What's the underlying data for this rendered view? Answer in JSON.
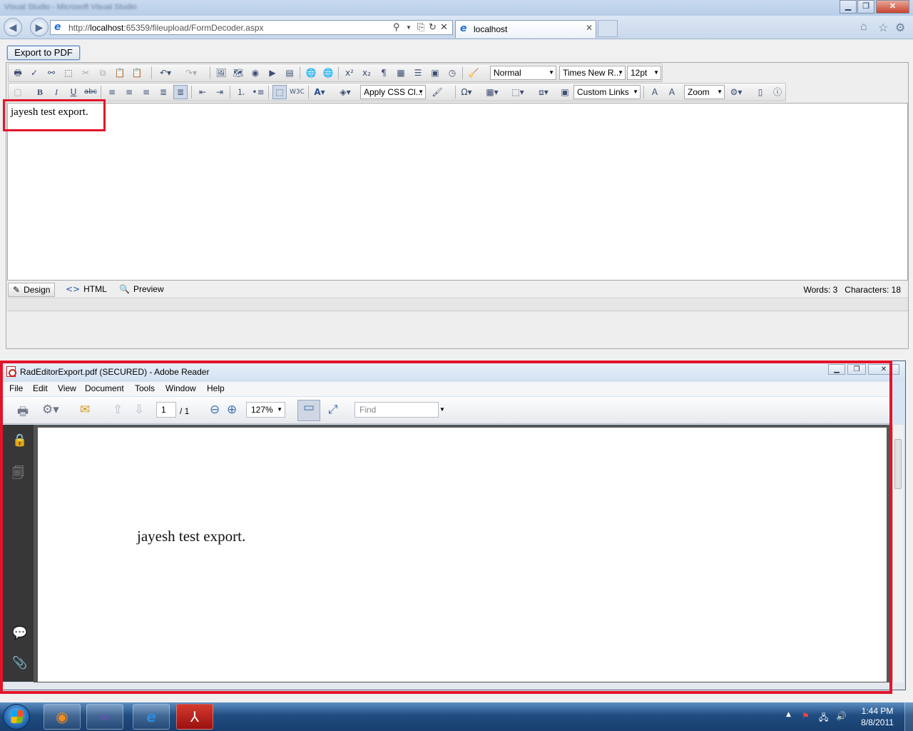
{
  "browser": {
    "title_blurred": "Visual Studio - Microsoft Visual Studio",
    "address": {
      "prefix": "http://",
      "host": "localhost",
      "rest": ":65359/fileupload/FormDecoder.aspx"
    },
    "tab_label": "localhost"
  },
  "page": {
    "export_button": "Export to PDF"
  },
  "editor": {
    "paragraph_style": "Normal",
    "font_name": "Times New R...",
    "font_size": "12pt",
    "css_class": "Apply CSS Cl...",
    "custom_links": "Custom Links",
    "zoom": "Zoom",
    "content_text": "jayesh test export.",
    "modes": [
      "Design",
      "HTML",
      "Preview"
    ],
    "words_label": "Words: 3",
    "chars_label": "Characters: 18"
  },
  "adobe": {
    "title": "RadEditorExport.pdf (SECURED) - Adobe Reader",
    "menu": [
      "File",
      "Edit",
      "View",
      "Document",
      "Tools",
      "Window",
      "Help"
    ],
    "page_current": "1",
    "page_total": "/ 1",
    "zoom": "127%",
    "find_placeholder": "Find",
    "pdf_text": "jayesh test export."
  },
  "taskbar": {
    "time": "1:44 PM",
    "date": "8/8/2011"
  },
  "colors": {
    "highlight": "#e2142a"
  }
}
